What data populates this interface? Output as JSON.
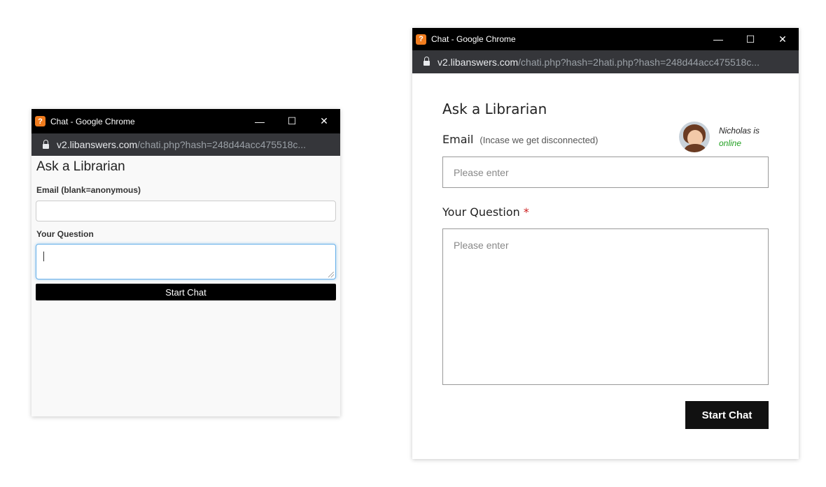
{
  "left_window": {
    "title": "Chat - Google Chrome",
    "url_host": "v2.libanswers.com",
    "url_path": "/chati.php?hash=248d44acc475518c...",
    "heading": "Ask a Librarian",
    "email_label": "Email (blank=anonymous)",
    "email_value": "",
    "question_label": "Your Question",
    "question_value": "",
    "button_label": "Start Chat"
  },
  "right_window": {
    "title": "Chat - Google Chrome",
    "url_host": "v2.libanswers.com",
    "url_path": "/chati.php?hash=2hati.php?hash=248d44acc475518c...",
    "heading": "Ask a Librarian",
    "agent": {
      "name": "Nicholas is",
      "status": "online"
    },
    "email_label": "Email",
    "email_note": "(Incase we get disconnected)",
    "email_placeholder": "Please enter",
    "question_label": "Your Question",
    "required_mark": "*",
    "question_placeholder": "Please enter",
    "button_label": "Start Chat"
  },
  "window_controls": {
    "minimize": "—",
    "maximize": "☐",
    "close": "✕"
  },
  "icons": {
    "app": "?",
    "lock": "lock-icon"
  },
  "colors": {
    "accent_orange": "#f07c1e",
    "online_green": "#22a022",
    "required_red": "#cc1f1f",
    "focus_blue": "#66afe9"
  }
}
